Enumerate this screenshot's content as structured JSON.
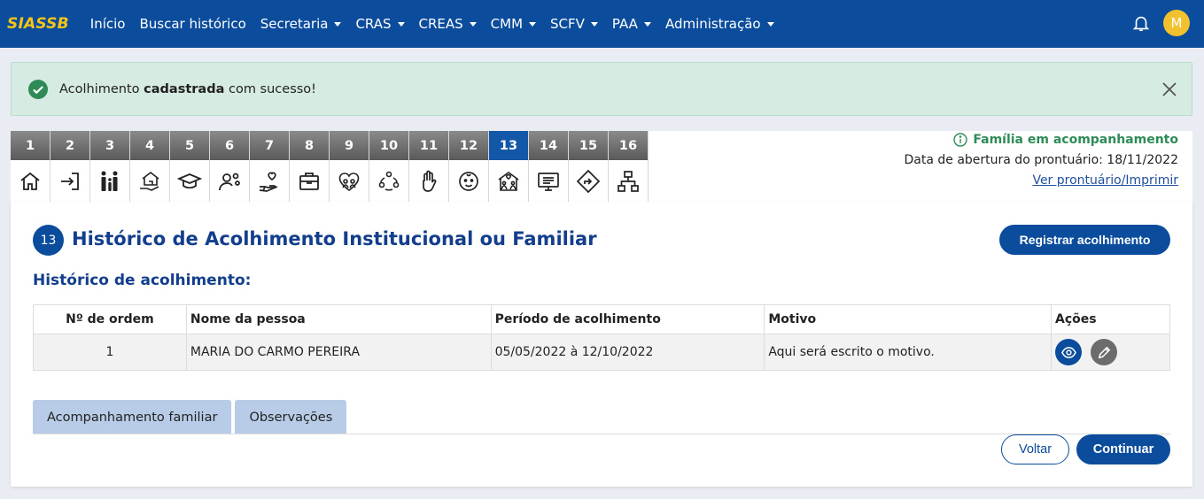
{
  "navbar": {
    "brand": "SIASSB",
    "items": [
      {
        "label": "Início",
        "dropdown": false
      },
      {
        "label": "Buscar histórico",
        "dropdown": false
      },
      {
        "label": "Secretaria",
        "dropdown": true
      },
      {
        "label": "CRAS",
        "dropdown": true
      },
      {
        "label": "CREAS",
        "dropdown": true
      },
      {
        "label": "CMM",
        "dropdown": true
      },
      {
        "label": "SCFV",
        "dropdown": true
      },
      {
        "label": "PAA",
        "dropdown": true
      },
      {
        "label": "Administração",
        "dropdown": true
      }
    ],
    "avatar_initial": "M",
    "avatar_color": "#f2c12e",
    "bell_icon": "bell-icon"
  },
  "alert": {
    "text_before": "Acolhimento ",
    "text_bold": "cadastrada",
    "text_after": " com sucesso!",
    "icon": "check-circle-icon",
    "color": "#d6ebe2"
  },
  "steps": {
    "active": "13",
    "items": [
      {
        "num": "1",
        "icon": "home-icon"
      },
      {
        "num": "2",
        "icon": "sign-in-icon"
      },
      {
        "num": "3",
        "icon": "family-icon"
      },
      {
        "num": "4",
        "icon": "house-hand-icon"
      },
      {
        "num": "5",
        "icon": "graduation-cap-icon"
      },
      {
        "num": "6",
        "icon": "person-gear-icon"
      },
      {
        "num": "7",
        "icon": "hand-heart-icon"
      },
      {
        "num": "8",
        "icon": "briefcase-icon"
      },
      {
        "num": "9",
        "icon": "group-heart-icon"
      },
      {
        "num": "10",
        "icon": "people-circle-icon"
      },
      {
        "num": "11",
        "icon": "hand-stop-icon"
      },
      {
        "num": "12",
        "icon": "child-face-icon"
      },
      {
        "num": "13",
        "icon": "house-family-icon"
      },
      {
        "num": "14",
        "icon": "screen-list-icon"
      },
      {
        "num": "15",
        "icon": "diamond-arrow-icon"
      },
      {
        "num": "16",
        "icon": "sitemap-icon"
      }
    ]
  },
  "info": {
    "status": "Família em acompanhamento",
    "opened_label": "Data de abertura do prontuário: 18/11/2022",
    "print_link": "Ver prontuário/Imprimir"
  },
  "section": {
    "number": "13",
    "title": "Histórico de Acolhimento Institucional ou Familiar",
    "register_button": "Registrar acolhimento",
    "subtitle": "Histórico de acolhimento:"
  },
  "table": {
    "headers": [
      "Nº de ordem",
      "Nome da pessoa",
      "Período de acolhimento",
      "Motivo",
      "Ações"
    ],
    "rows": [
      {
        "ordem": "1",
        "nome": "MARIA DO CARMO PEREIRA",
        "periodo": "05/05/2022 à 12/10/2022",
        "motivo": "Aqui será escrito o motivo."
      }
    ]
  },
  "tabs": [
    "Acompanhamento familiar",
    "Observações"
  ],
  "footer": {
    "back": "Voltar",
    "continue": "Continuar"
  },
  "colors": {
    "primary": "#0b4c9c",
    "title": "#123e8c",
    "success": "#2e8b57"
  }
}
